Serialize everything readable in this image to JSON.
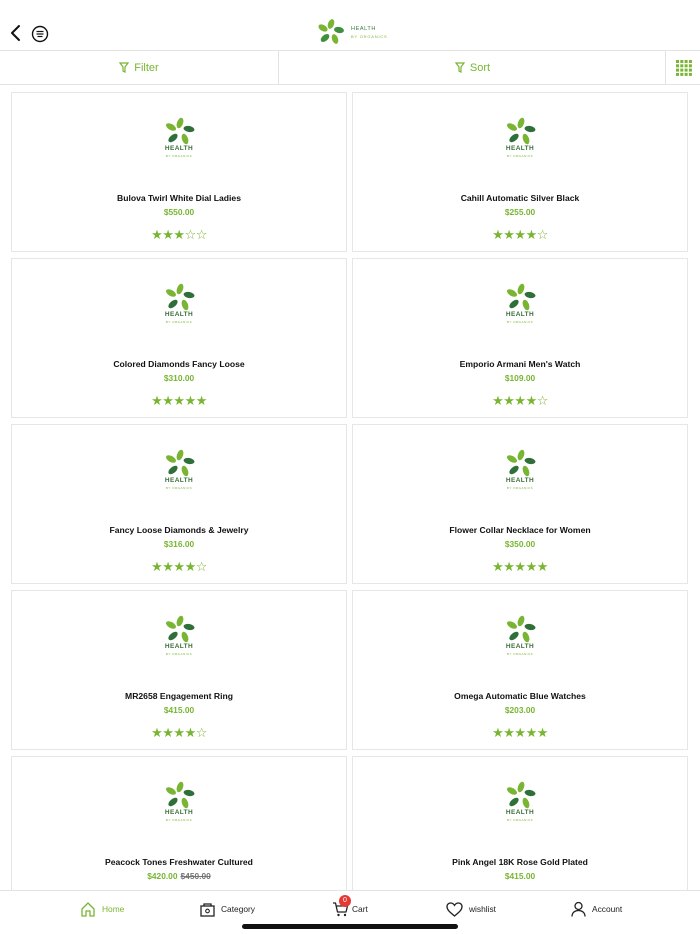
{
  "header": {
    "logo_text": "HEALTH",
    "logo_subtext": "BY ORGANICS"
  },
  "toolbar": {
    "filter_label": "Filter",
    "sort_label": "Sort"
  },
  "product_logo": {
    "label": "HEALTH",
    "sub": "BY ORGANICS"
  },
  "products": [
    {
      "name": "Bulova Twirl White Dial Ladies",
      "price": "$550.00",
      "old_price": "",
      "rating": 3
    },
    {
      "name": "Cahill Automatic Silver Black",
      "price": "$255.00",
      "old_price": "",
      "rating": 4
    },
    {
      "name": "Colored Diamonds Fancy Loose",
      "price": "$310.00",
      "old_price": "",
      "rating": 5
    },
    {
      "name": "Emporio Armani Men's Watch",
      "price": "$109.00",
      "old_price": "",
      "rating": 4
    },
    {
      "name": "Fancy Loose Diamonds & Jewelry",
      "price": "$316.00",
      "old_price": "",
      "rating": 4
    },
    {
      "name": "Flower Collar Necklace for Women",
      "price": "$350.00",
      "old_price": "",
      "rating": 5
    },
    {
      "name": "MR2658 Engagement Ring",
      "price": "$415.00",
      "old_price": "",
      "rating": 4
    },
    {
      "name": "Omega Automatic Blue Watches",
      "price": "$203.00",
      "old_price": "",
      "rating": 5
    },
    {
      "name": "Peacock Tones Freshwater Cultured",
      "price": "$420.00",
      "old_price": "$450.00",
      "rating": 0
    },
    {
      "name": "Pink Angel 18K Rose Gold Plated",
      "price": "$415.00",
      "old_price": "",
      "rating": 0
    }
  ],
  "bottom_nav": {
    "home": "Home",
    "category": "Category",
    "cart": "Cart",
    "cart_count": "0",
    "wishlist": "wishlist",
    "account": "Account"
  },
  "colors": {
    "accent": "#79b532",
    "badge": "#e53935"
  },
  "icons": [
    "back-arrow-icon",
    "menu-icon",
    "filter-icon",
    "sort-icon",
    "grid-view-icon",
    "home-icon",
    "category-icon",
    "cart-icon",
    "heart-icon",
    "account-icon",
    "star-icon"
  ]
}
